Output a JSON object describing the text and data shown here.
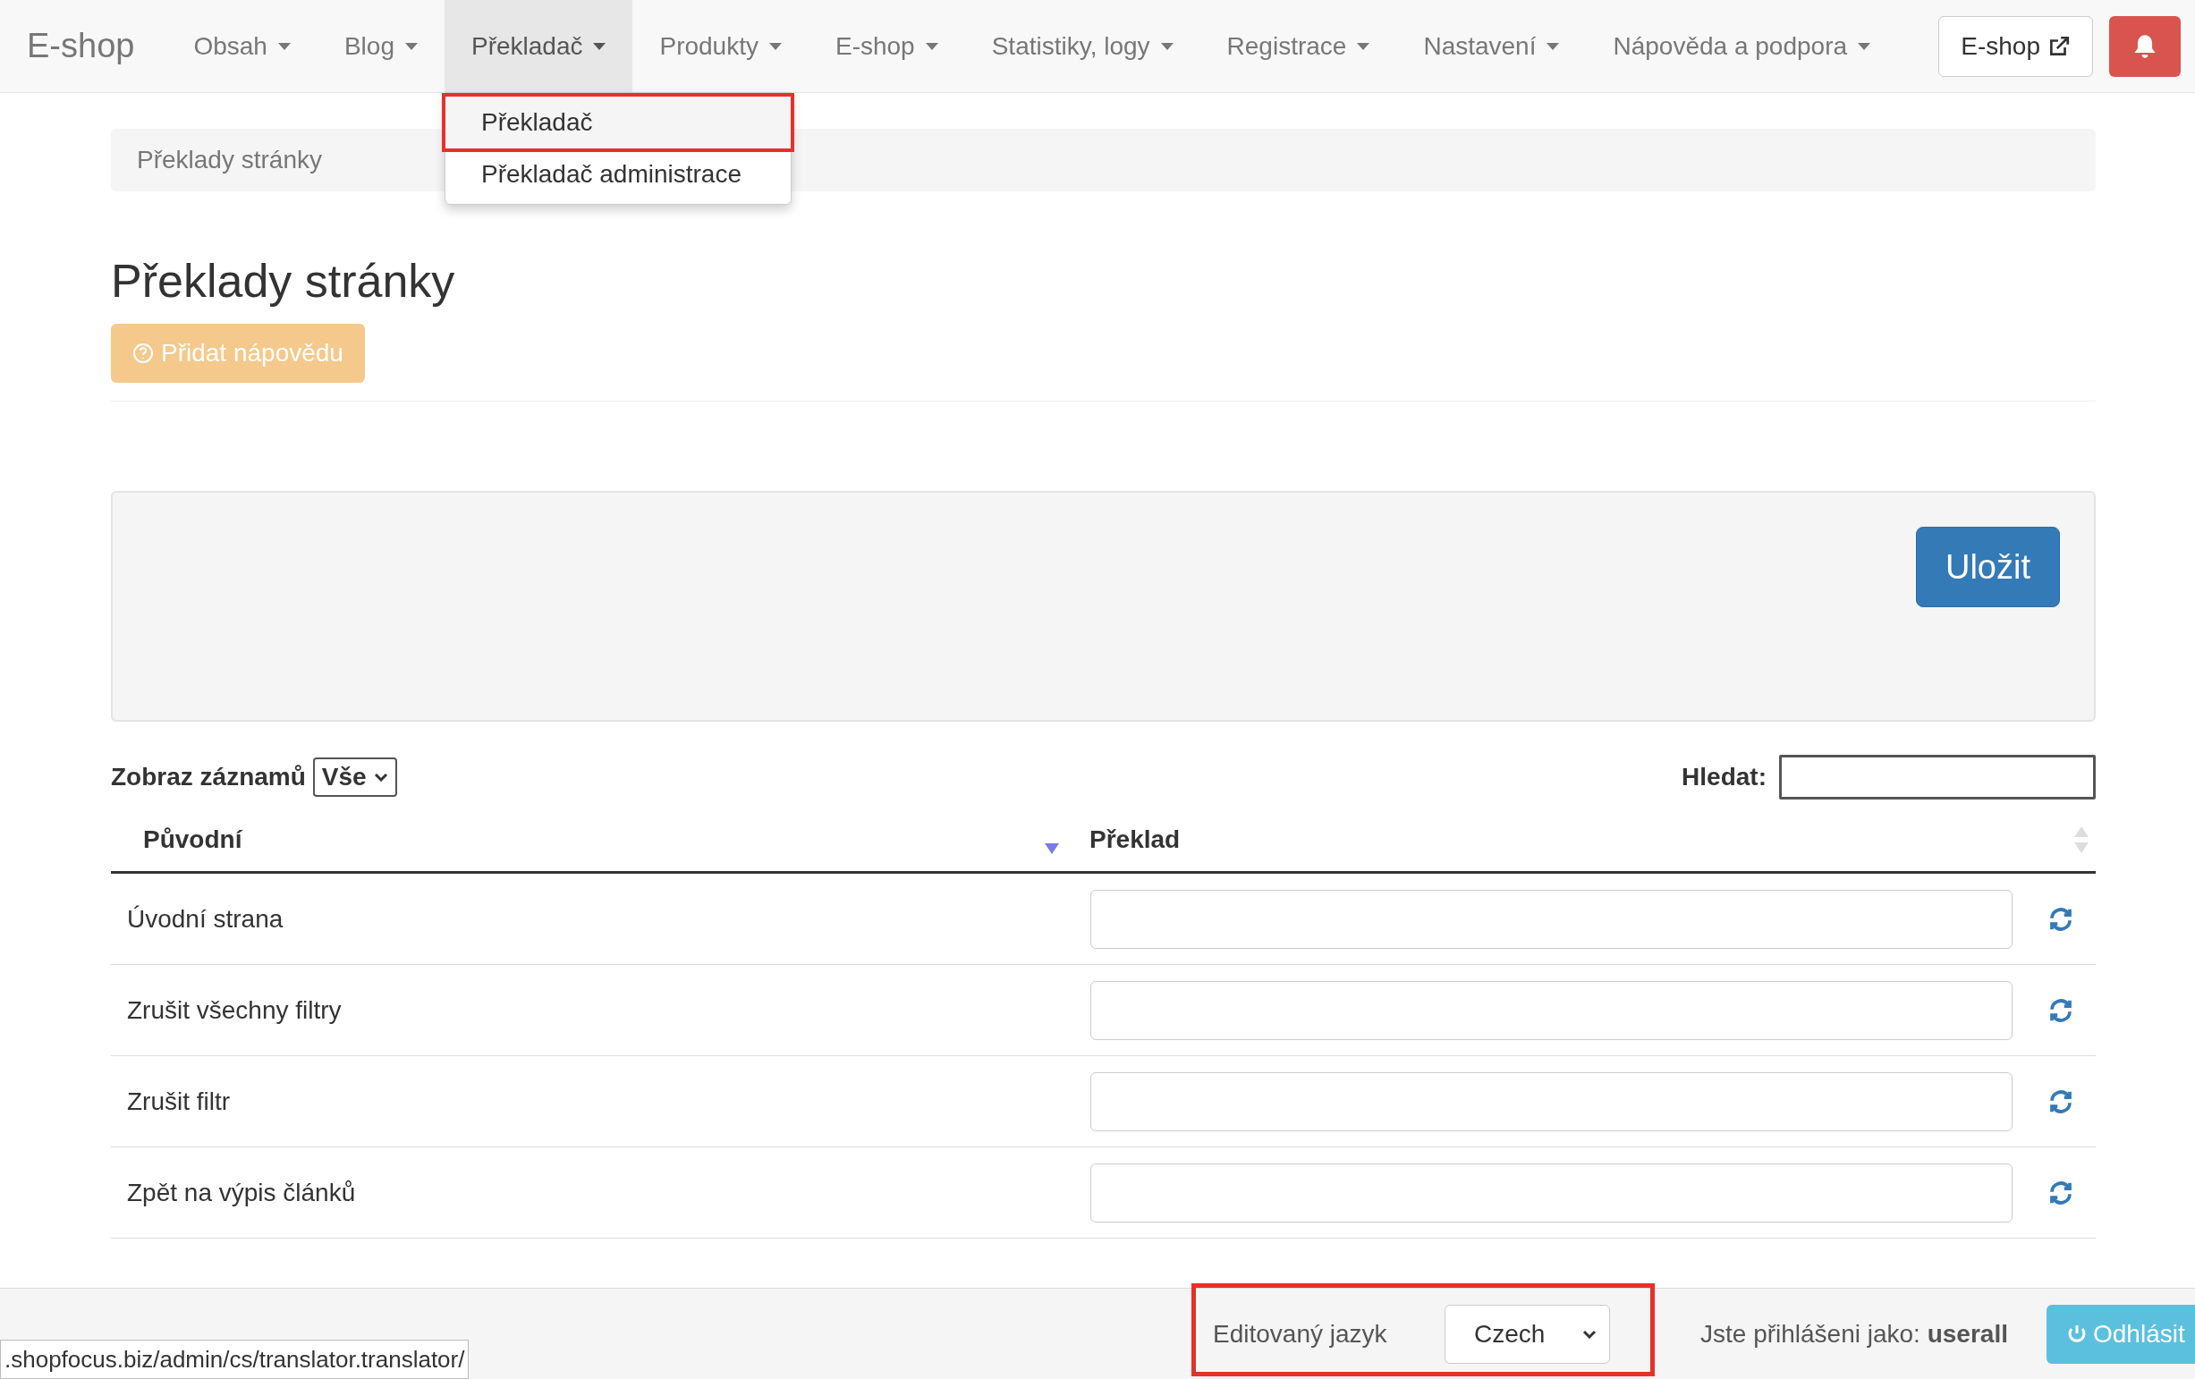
{
  "navbar": {
    "brand": "E-shop",
    "items": [
      {
        "label": "Obsah",
        "selected": false,
        "expanded": false
      },
      {
        "label": "Blog",
        "selected": false,
        "expanded": false
      },
      {
        "label": "Překladač",
        "selected": true,
        "expanded": true
      },
      {
        "label": "Produkty",
        "selected": false,
        "expanded": false
      },
      {
        "label": "E-shop",
        "selected": false,
        "expanded": false
      },
      {
        "label": "Statistiky, logy",
        "selected": false,
        "expanded": false
      },
      {
        "label": "Registrace",
        "selected": false,
        "expanded": false
      },
      {
        "label": "Nastavení",
        "selected": false,
        "expanded": false
      },
      {
        "label": "Nápověda a podpora",
        "selected": false,
        "expanded": false
      }
    ],
    "external_button": "E-shop"
  },
  "dropdown": {
    "items": [
      {
        "label": "Překladač",
        "highlighted": true
      },
      {
        "label": "Překladač administrace",
        "highlighted": false
      }
    ]
  },
  "breadcrumb": "Překlady stránky",
  "heading": "Překlady stránky",
  "help_button": "Přidat nápovědu",
  "save_button": "Uložit",
  "table_controls": {
    "length_label": "Zobraz záznamů",
    "length_value": "Vše",
    "search_label": "Hledat:"
  },
  "table": {
    "columns": [
      {
        "label": "Původní",
        "sorted": true
      },
      {
        "label": "Překlad",
        "sorted": false
      }
    ],
    "rows": [
      {
        "original": "Úvodní strana"
      },
      {
        "original": "Zrušit všechny filtry"
      },
      {
        "original": "Zrušit filtr"
      },
      {
        "original": "Zpět na výpis článků"
      }
    ]
  },
  "footer": {
    "language_label": "Editovaný jazyk",
    "language_value": "Czech",
    "language_highlighted": true,
    "logged_in_label": "Jste přihlášeni jako:",
    "user": "userall",
    "logout_button": "Odhlásit"
  },
  "status_url": ".shopfocus.biz/admin/cs/translator.translator/"
}
